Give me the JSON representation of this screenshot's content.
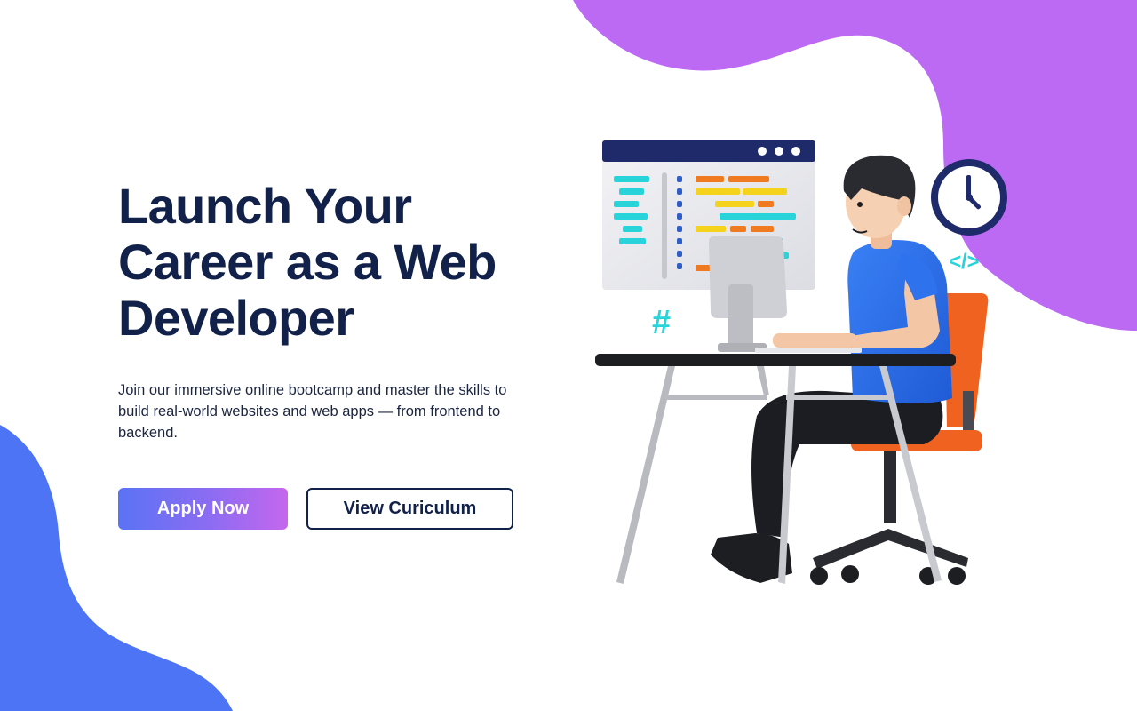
{
  "hero": {
    "headline_lines": [
      "Launch Your",
      "Career as a Web",
      "Developer"
    ],
    "subtitle": "Join our immersive online bootcamp and master the skills to build real-world websites and web apps — from frontend to backend."
  },
  "actions": {
    "primary_label": "Apply Now",
    "secondary_label": "View Curiculum"
  },
  "illustration": {
    "hash_symbol": "#",
    "code_tag_symbol": "</>"
  },
  "colors": {
    "navy": "#11214a",
    "purple_blob": "#bc6af4",
    "blue_blob": "#4e74f6",
    "button_gradient_start": "#5a73f5",
    "button_gradient_end": "#c467ee",
    "accent_cyan": "#29d3da",
    "accent_orange": "#f0621f",
    "shirt_blue": "#2f72ee"
  }
}
